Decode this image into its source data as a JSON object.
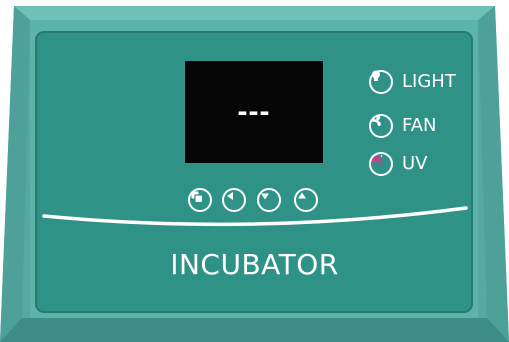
{
  "colors": {
    "body": "#54aaa0",
    "bevel_light": "#6fc1b7",
    "bevel_dark": "#3d8d84",
    "panel": "#2f9287",
    "display": "#050505",
    "text": "#ffffff",
    "uv_lamp": "#c2418f"
  },
  "display": {
    "readout": "---"
  },
  "indicators": [
    {
      "label": "LIGHT",
      "icon": "bulb-icon"
    },
    {
      "label": "FAN",
      "icon": "fan-icon"
    },
    {
      "label": "UV",
      "icon": "uv-lamp-icon"
    }
  ],
  "buttons": [
    {
      "icon": "copy-icon"
    },
    {
      "icon": "arrow-left-icon"
    },
    {
      "icon": "arrow-down-icon"
    },
    {
      "icon": "arrow-up-icon"
    }
  ],
  "brand": {
    "label": "INCUBATOR"
  }
}
